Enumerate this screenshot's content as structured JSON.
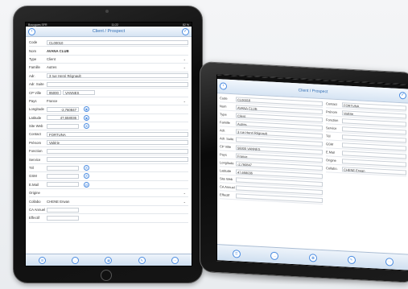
{
  "left": {
    "status": {
      "carrier": "Bouygues SFR",
      "time": "11:22",
      "battery": "82 %"
    },
    "title": "Client / Prospect",
    "fields": [
      {
        "label": "Code",
        "value": "CL00010",
        "kind": "input"
      },
      {
        "label": "Nom",
        "value": "AVANA CLUB",
        "kind": "bold"
      },
      {
        "label": "Type",
        "value": "Client",
        "kind": "select"
      },
      {
        "label": "Famille",
        "value": "Autres",
        "kind": "select"
      },
      {
        "label": "Adr.",
        "value": "3 rue Henri Régnault",
        "kind": "input"
      },
      {
        "label": "Adr. Suite",
        "value": "",
        "kind": "input"
      },
      {
        "label": "CP Ville",
        "value": "95000",
        "value2": "VANNES",
        "kind": "cpville"
      },
      {
        "label": "Pays",
        "value": "France",
        "kind": "select"
      },
      {
        "label": "Longitude",
        "value": "-2,760847",
        "kind": "geo"
      },
      {
        "label": "Latitude",
        "value": "47,658036",
        "kind": "geo"
      },
      {
        "label": "Site Web",
        "value": "",
        "kind": "web"
      },
      {
        "label": "Contact",
        "value": "FORTUNA",
        "kind": "input"
      },
      {
        "label": "Prénom",
        "value": "Valérie",
        "kind": "input"
      },
      {
        "label": "Fonction",
        "value": "",
        "kind": "input"
      },
      {
        "label": "Service",
        "value": "",
        "kind": "input"
      },
      {
        "label": "Tél",
        "value": "",
        "kind": "phone"
      },
      {
        "label": "GSM",
        "value": "",
        "kind": "phone"
      },
      {
        "label": "E.Mail",
        "value": "",
        "kind": "mail"
      },
      {
        "label": "Origine",
        "value": "",
        "kind": "select"
      },
      {
        "label": "Collabo",
        "value": "CHENE Erwan",
        "kind": "select"
      },
      {
        "label": "CA Annuel",
        "value": "",
        "kind": "short"
      },
      {
        "label": "Effectif",
        "value": "",
        "kind": "short"
      }
    ]
  },
  "right": {
    "title": "Client / Prospect",
    "col_a": [
      {
        "label": "Code",
        "value": "CL00018"
      },
      {
        "label": "Nom",
        "value": "AVANA CLUB"
      },
      {
        "label": "Type",
        "value": "Client"
      },
      {
        "label": "Famille",
        "value": "Autres"
      },
      {
        "label": "Adr.",
        "value": "3 rue Henri Régnault"
      },
      {
        "label": "Adr. Suite",
        "value": ""
      },
      {
        "label": "CP Ville",
        "value": "56000  VANNES"
      },
      {
        "label": "Pays",
        "value": "France"
      },
      {
        "label": "Longitude",
        "value": "-2,760847"
      },
      {
        "label": "Latitude",
        "value": "47,658036"
      },
      {
        "label": "Site Web",
        "value": ""
      },
      {
        "label": "CA Annuel",
        "value": ""
      },
      {
        "label": "Effectif",
        "value": ""
      }
    ],
    "col_b": [
      {
        "label": "Contact",
        "value": "FORTUNA"
      },
      {
        "label": "Prénom",
        "value": "Valérie"
      },
      {
        "label": "Fonction",
        "value": ""
      },
      {
        "label": "Service",
        "value": ""
      },
      {
        "label": "Tél",
        "value": ""
      },
      {
        "label": "GSM",
        "value": ""
      },
      {
        "label": "E.Mail",
        "value": ""
      },
      {
        "label": "Origine",
        "value": ""
      },
      {
        "label": "Collabo.",
        "value": "CHENE Erwan"
      }
    ]
  },
  "colors": {
    "accent": "#4a8be0",
    "nav_title": "#2d6bb3"
  }
}
